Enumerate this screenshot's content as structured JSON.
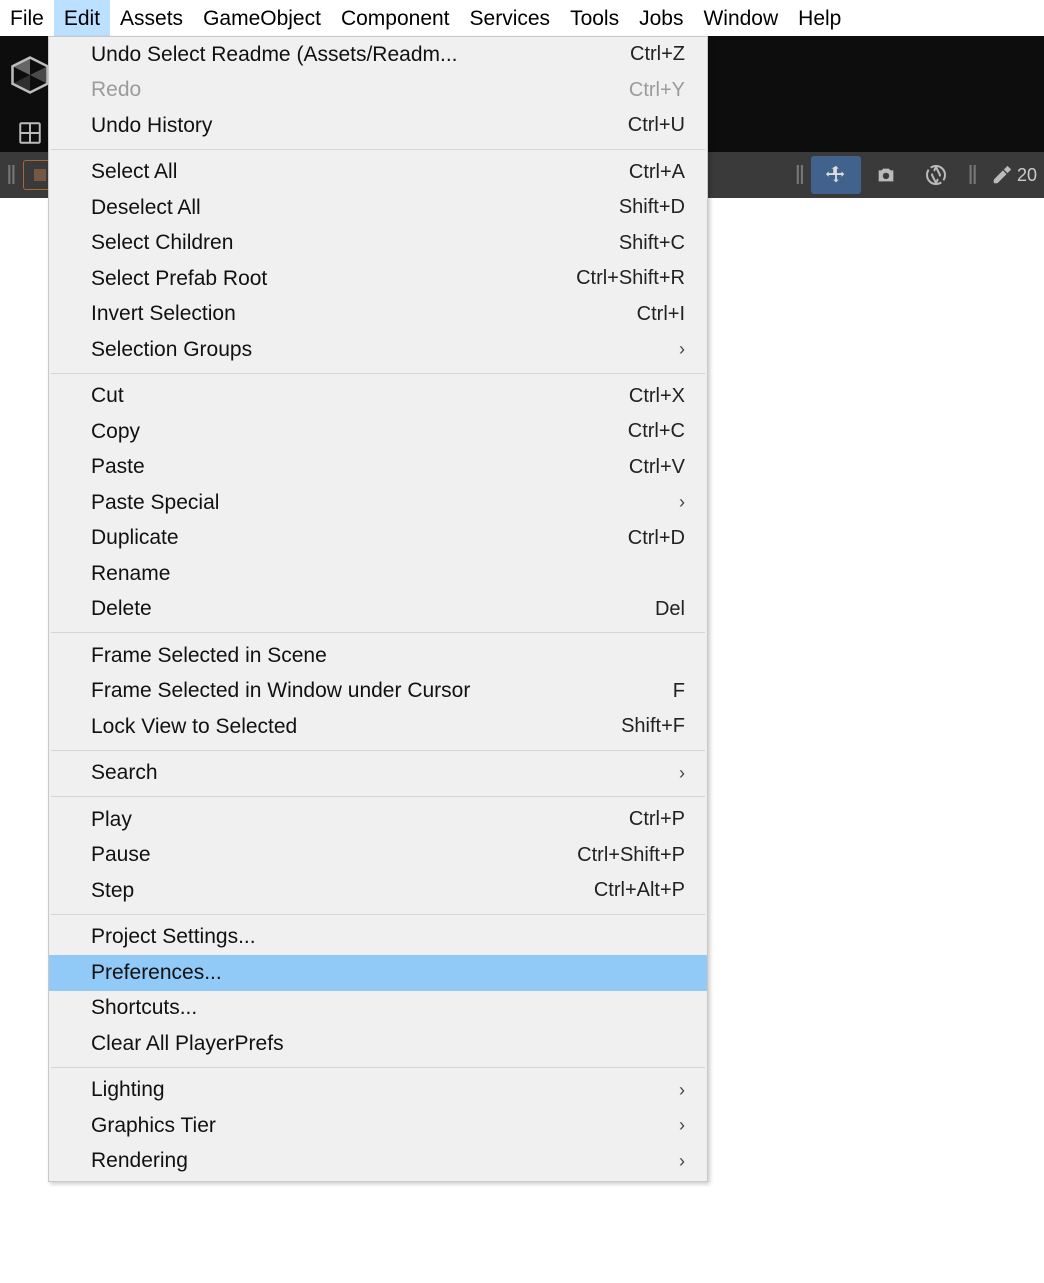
{
  "menubar": {
    "items": [
      {
        "label": "File"
      },
      {
        "label": "Edit",
        "active": true
      },
      {
        "label": "Assets"
      },
      {
        "label": "GameObject"
      },
      {
        "label": "Component"
      },
      {
        "label": "Services"
      },
      {
        "label": "Tools"
      },
      {
        "label": "Jobs"
      },
      {
        "label": "Window"
      },
      {
        "label": "Help"
      }
    ]
  },
  "toolbar": {
    "grid_glyph": "#",
    "right_text": "20"
  },
  "dropdown": {
    "groups": [
      [
        {
          "label": "Undo Select Readme (Assets/Readm...",
          "shortcut": "Ctrl+Z"
        },
        {
          "label": "Redo",
          "shortcut": "Ctrl+Y",
          "disabled": true
        },
        {
          "label": "Undo History",
          "shortcut": "Ctrl+U"
        }
      ],
      [
        {
          "label": "Select All",
          "shortcut": "Ctrl+A"
        },
        {
          "label": "Deselect All",
          "shortcut": "Shift+D"
        },
        {
          "label": "Select Children",
          "shortcut": "Shift+C"
        },
        {
          "label": "Select Prefab Root",
          "shortcut": "Ctrl+Shift+R"
        },
        {
          "label": "Invert Selection",
          "shortcut": "Ctrl+I"
        },
        {
          "label": "Selection Groups",
          "submenu": true
        }
      ],
      [
        {
          "label": "Cut",
          "shortcut": "Ctrl+X"
        },
        {
          "label": "Copy",
          "shortcut": "Ctrl+C"
        },
        {
          "label": "Paste",
          "shortcut": "Ctrl+V"
        },
        {
          "label": "Paste Special",
          "submenu": true
        },
        {
          "label": "Duplicate",
          "shortcut": "Ctrl+D"
        },
        {
          "label": "Rename"
        },
        {
          "label": "Delete",
          "shortcut": "Del"
        }
      ],
      [
        {
          "label": "Frame Selected in Scene"
        },
        {
          "label": "Frame Selected in Window under Cursor",
          "shortcut": "F"
        },
        {
          "label": "Lock View to Selected",
          "shortcut": "Shift+F"
        }
      ],
      [
        {
          "label": "Search",
          "submenu": true
        }
      ],
      [
        {
          "label": "Play",
          "shortcut": "Ctrl+P"
        },
        {
          "label": "Pause",
          "shortcut": "Ctrl+Shift+P"
        },
        {
          "label": "Step",
          "shortcut": "Ctrl+Alt+P"
        }
      ],
      [
        {
          "label": "Project Settings..."
        },
        {
          "label": "Preferences...",
          "highlight": true
        },
        {
          "label": "Shortcuts..."
        },
        {
          "label": "Clear All PlayerPrefs"
        }
      ],
      [
        {
          "label": "Lighting",
          "submenu": true
        },
        {
          "label": "Graphics Tier",
          "submenu": true
        },
        {
          "label": "Rendering",
          "submenu": true
        }
      ]
    ]
  }
}
